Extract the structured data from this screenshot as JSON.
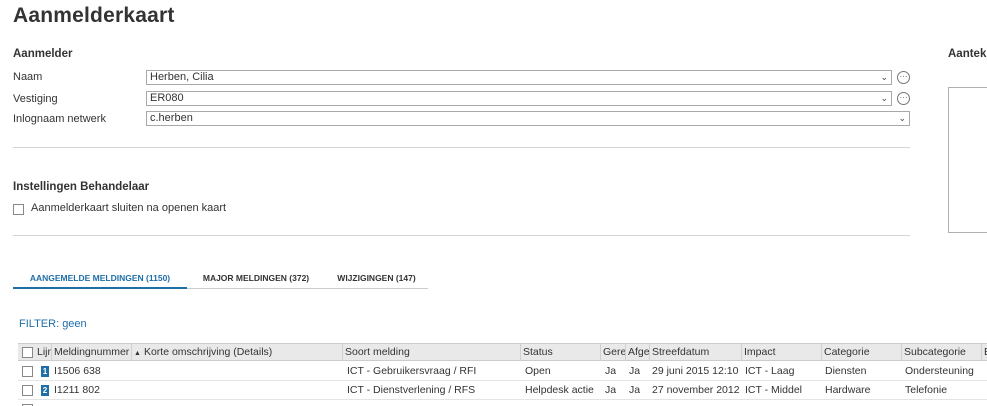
{
  "page_title": "Aanmelderkaart",
  "aanmelder": {
    "heading": "Aanmelder",
    "naam_label": "Naam",
    "naam_value": "Herben, Cilia",
    "vestiging_label": "Vestiging",
    "vestiging_value": "ER080",
    "inlognaam_label": "Inlognaam netwerk",
    "inlognaam_value": "c.herben"
  },
  "notes": {
    "heading": "Aantek"
  },
  "instellingen": {
    "heading": "Instellingen Behandelaar",
    "checkbox_label": "Aanmelderkaart sluiten na openen kaart",
    "checkbox_checked": false
  },
  "tabs": [
    {
      "label": "AANGEMELDE MELDINGEN (1150)",
      "active": true
    },
    {
      "label": "MAJOR MELDINGEN (372)",
      "active": false
    },
    {
      "label": "WIJZIGINGEN (147)",
      "active": false
    }
  ],
  "filter_text": "FILTER: geen",
  "grid": {
    "columns": [
      "Lijn",
      "Meldingnummer",
      "Korte omschrijving (Details)",
      "Soort melding",
      "Status",
      "Gere",
      "Afger",
      "Streefdatum",
      "Impact",
      "Categorie",
      "Subcategorie",
      "B"
    ],
    "sorted_column": "Korte omschrijving (Details)",
    "rows": [
      {
        "lijn": "1",
        "meldingnummer": "I1506 638",
        "omschrijving": "",
        "soort": "ICT - Gebruikersvraag / RFI",
        "status": "Open",
        "gere": "Ja",
        "afger": "Ja",
        "streefdatum": "29 juni 2015 12:10",
        "impact": "ICT - Laag",
        "categorie": "Diensten",
        "subcategorie": "Ondersteuning"
      },
      {
        "lijn": "2",
        "meldingnummer": "I1211 802",
        "omschrijving": "",
        "soort": "ICT - Dienstverlening / RFS",
        "status": "Helpdesk actie",
        "gere": "Ja",
        "afger": "Ja",
        "streefdatum": "27 november 2012",
        "impact": "ICT - Middel",
        "categorie": "Hardware",
        "subcategorie": "Telefonie"
      }
    ]
  },
  "colors": {
    "accent": "#1e6ea8",
    "header_bg": "#e9e9e9"
  }
}
